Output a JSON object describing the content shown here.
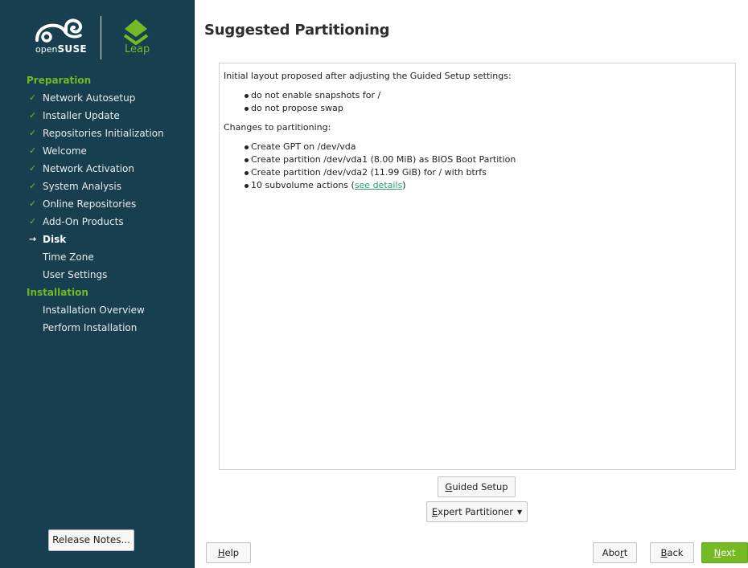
{
  "brand": {
    "suse_prefix": "open",
    "suse_name": "SUSE",
    "leap": "Leap",
    "accent_color": "#73ba25",
    "sidebar_color": "#173f4f"
  },
  "sidebar": {
    "sections": [
      {
        "title": "Preparation",
        "items": [
          {
            "label": "Network Autosetup",
            "status": "done",
            "mark": "✓"
          },
          {
            "label": "Installer Update",
            "status": "done",
            "mark": "✓"
          },
          {
            "label": "Repositories Initialization",
            "status": "done",
            "mark": "✓"
          },
          {
            "label": "Welcome",
            "status": "done",
            "mark": "✓"
          },
          {
            "label": "Network Activation",
            "status": "done",
            "mark": "✓"
          },
          {
            "label": "System Analysis",
            "status": "done",
            "mark": "✓"
          },
          {
            "label": "Online Repositories",
            "status": "done",
            "mark": "✓"
          },
          {
            "label": "Add-On Products",
            "status": "done",
            "mark": "✓"
          },
          {
            "label": "Disk",
            "status": "current",
            "mark": "→"
          },
          {
            "label": "Time Zone",
            "status": "pending",
            "mark": ""
          },
          {
            "label": "User Settings",
            "status": "pending",
            "mark": ""
          }
        ]
      },
      {
        "title": "Installation",
        "items": [
          {
            "label": "Installation Overview",
            "status": "pending",
            "mark": ""
          },
          {
            "label": "Perform Installation",
            "status": "pending",
            "mark": ""
          }
        ]
      }
    ],
    "release_notes_label": "Release Notes..."
  },
  "main": {
    "title": "Suggested Partitioning",
    "intro": "Initial layout proposed after adjusting the Guided Setup settings:",
    "settings": [
      "do not enable snapshots for /",
      "do not propose swap"
    ],
    "changes_heading": "Changes to partitioning:",
    "changes": [
      "Create GPT on /dev/vda",
      "Create partition /dev/vda1 (8.00 MiB) as BIOS Boot Partition",
      "Create partition /dev/vda2 (11.99 GiB) for / with btrfs"
    ],
    "subvolume_prefix": "10 subvolume actions (",
    "subvolume_link": "see details",
    "subvolume_suffix": ")"
  },
  "buttons": {
    "guided_setup": {
      "key": "G",
      "rest": "uided Setup"
    },
    "expert_partitioner": {
      "key": "E",
      "rest": "xpert Partitioner"
    },
    "help": {
      "key": "H",
      "rest": "elp"
    },
    "abort": {
      "pre": "Abo",
      "key": "r",
      "rest": "t"
    },
    "back": {
      "key": "B",
      "rest": "ack"
    },
    "next": {
      "key": "N",
      "rest": "ext"
    }
  }
}
